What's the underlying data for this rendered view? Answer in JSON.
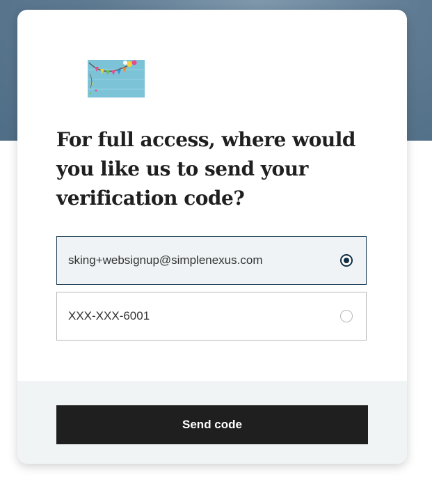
{
  "colors": {
    "header_backdrop": "#5e7a92",
    "selected_border": "#1b3a52",
    "selected_background": "#eff3f5",
    "radio_accent": "#0f2d44",
    "button_background": "#1f1f1f",
    "button_text": "#ffffff",
    "footer_background": "#f0f4f5"
  },
  "logo": {
    "icon": "party-banner-logo"
  },
  "heading": "For full access, where would you like us to send your verification code?",
  "options": [
    {
      "label": "sking+websignup@simplenexus.com",
      "selected": true
    },
    {
      "label": "XXX-XXX-6001",
      "selected": false
    }
  ],
  "footer": {
    "send_label": "Send code"
  }
}
